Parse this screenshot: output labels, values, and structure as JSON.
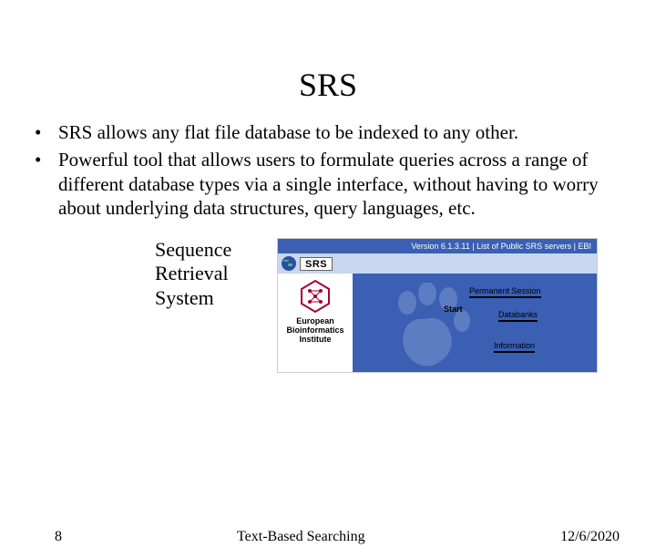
{
  "title": "SRS",
  "bullets": [
    "SRS allows any flat file database to be indexed to any other.",
    "Powerful tool that allows users to formulate queries across a range of different database types via a single interface, without having to worry about underlying data structures, query languages, etc."
  ],
  "expansion": {
    "line1": "Sequence",
    "line2": "Retrieval",
    "line3": "System"
  },
  "screenshot": {
    "topbar": "Version 6.1.3.11 | List of Public SRS servers | EBI",
    "logo": "SRS",
    "institute_line1": "European",
    "institute_line2": "Bioinformatics",
    "institute_line3": "Institute",
    "sidetext": "EBI",
    "link_permanent": "Permanent Session",
    "link_start": "Start",
    "link_databanks": "Databanks",
    "link_information": "Information"
  },
  "footer": {
    "page": "8",
    "center": "Text-Based Searching",
    "date": "12/6/2020"
  }
}
